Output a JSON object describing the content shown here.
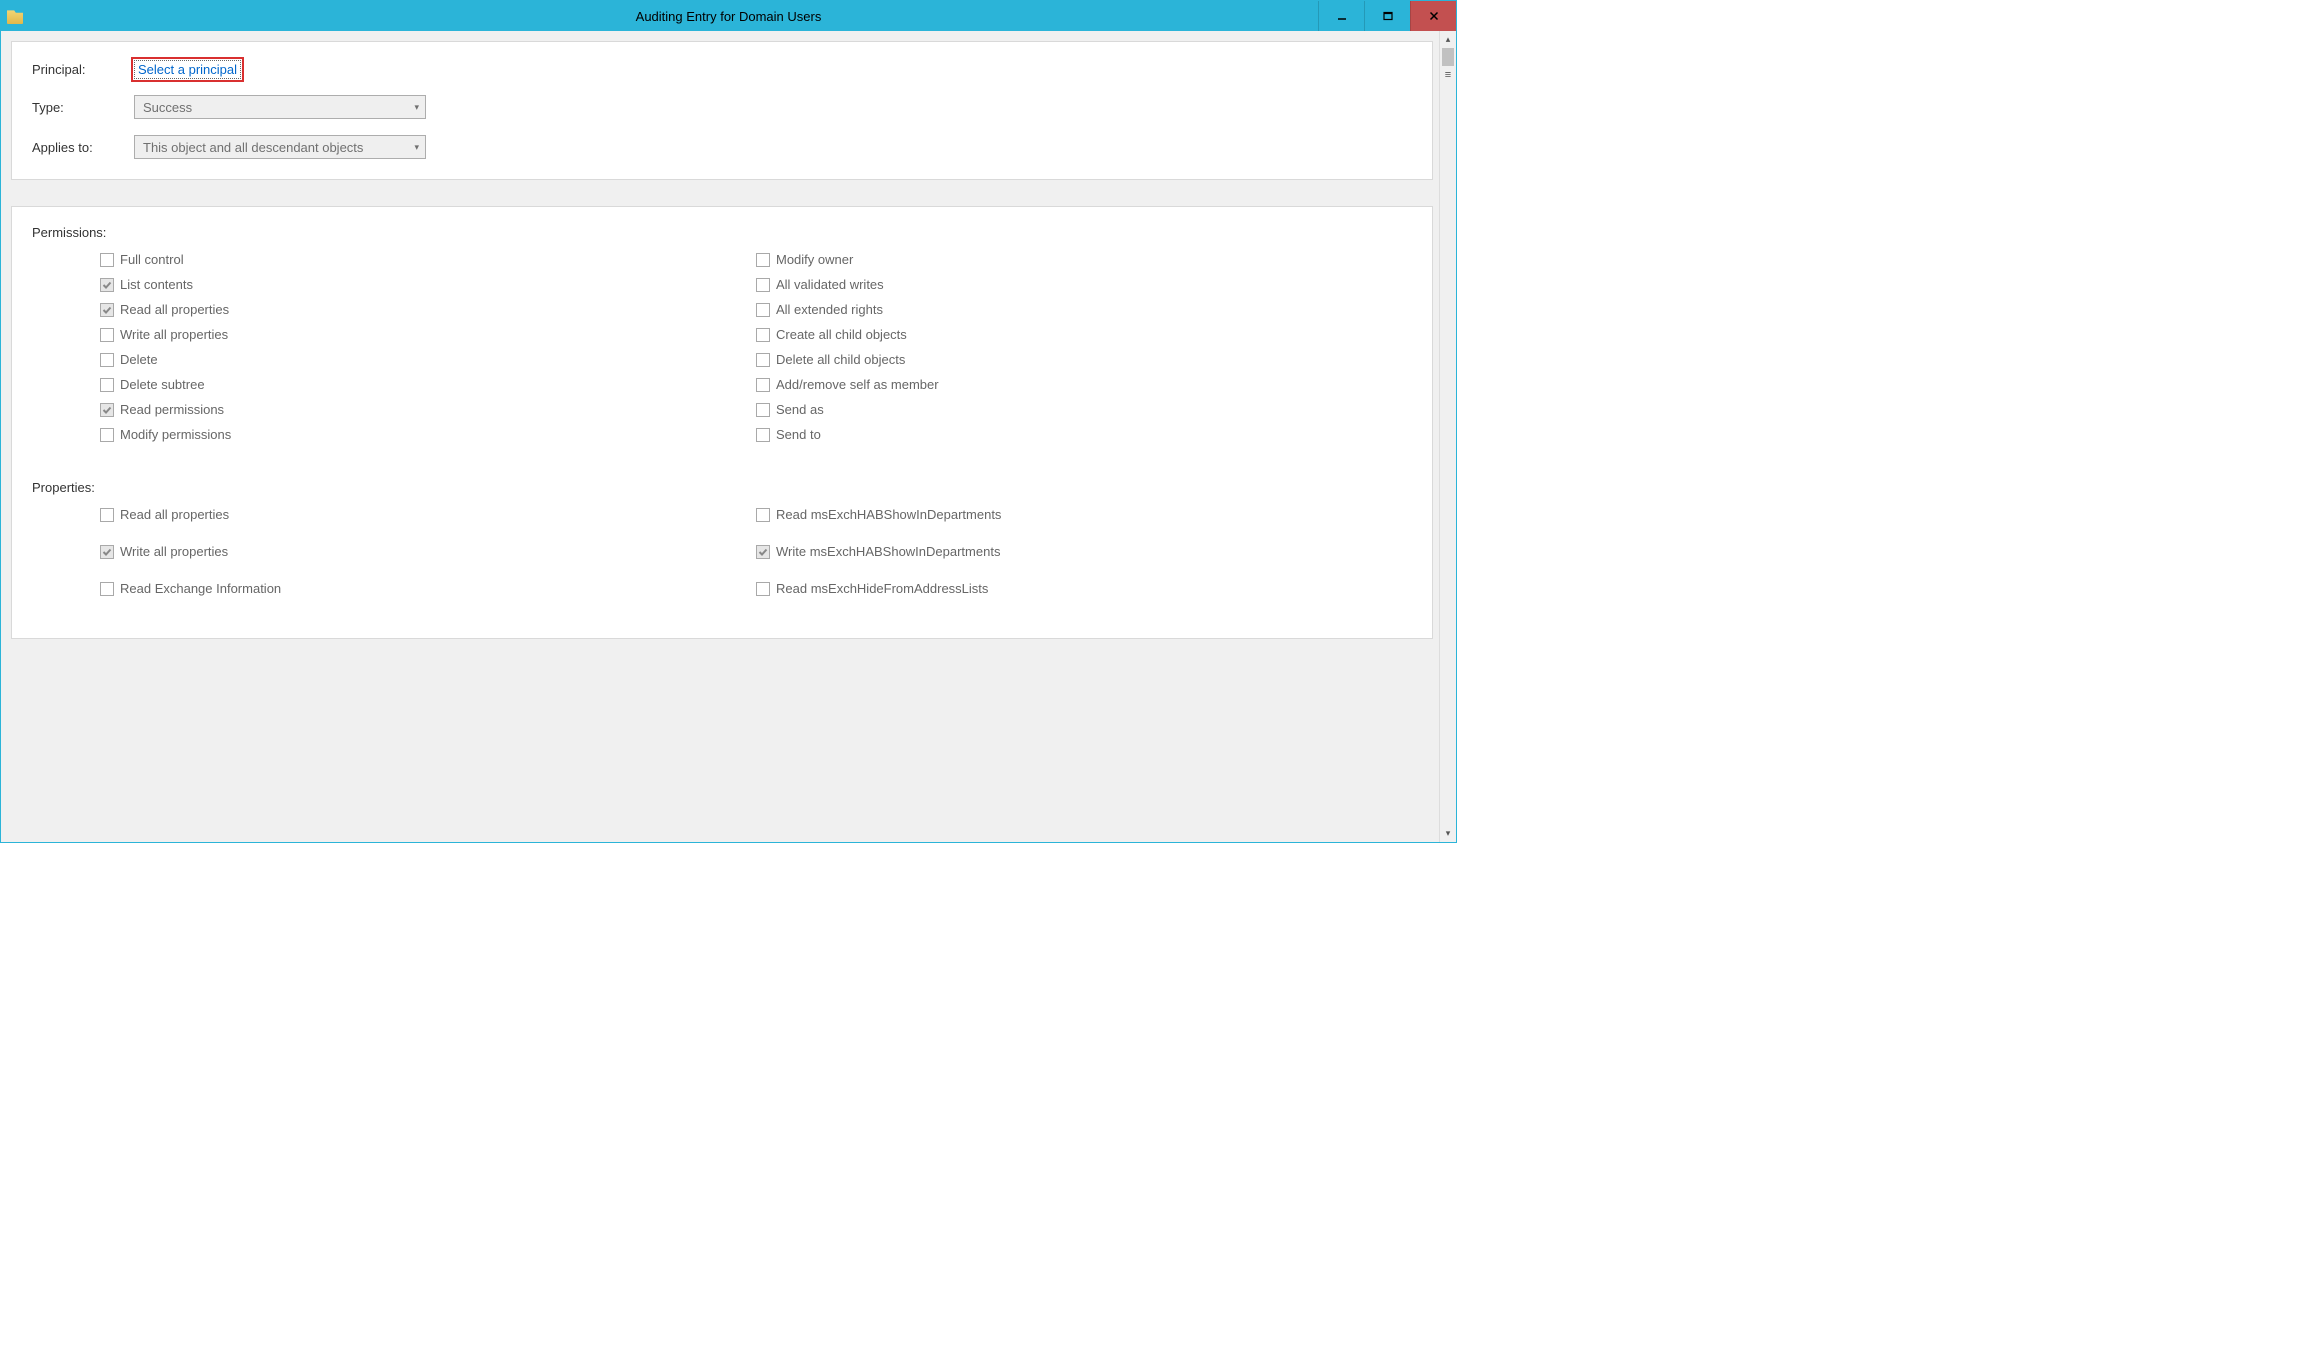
{
  "window": {
    "title": "Auditing Entry for Domain Users"
  },
  "form": {
    "principal_label": "Principal:",
    "principal_link": "Select a principal",
    "type_label": "Type:",
    "type_value": "Success",
    "appliesto_label": "Applies to:",
    "appliesto_value": "This object and all descendant objects"
  },
  "permissions": {
    "heading": "Permissions:",
    "col1": [
      {
        "label": "Full control",
        "checked": false
      },
      {
        "label": "List contents",
        "checked": true
      },
      {
        "label": "Read all properties",
        "checked": true
      },
      {
        "label": "Write all properties",
        "checked": false
      },
      {
        "label": "Delete",
        "checked": false
      },
      {
        "label": "Delete subtree",
        "checked": false
      },
      {
        "label": "Read permissions",
        "checked": true
      },
      {
        "label": "Modify permissions",
        "checked": false
      }
    ],
    "col2": [
      {
        "label": "Modify owner",
        "checked": false
      },
      {
        "label": "All validated writes",
        "checked": false
      },
      {
        "label": "All extended rights",
        "checked": false
      },
      {
        "label": "Create all child objects",
        "checked": false
      },
      {
        "label": "Delete all child objects",
        "checked": false
      },
      {
        "label": "Add/remove self as member",
        "checked": false
      },
      {
        "label": "Send as",
        "checked": false
      },
      {
        "label": "Send to",
        "checked": false
      }
    ]
  },
  "properties": {
    "heading": "Properties:",
    "col1": [
      {
        "label": "Read all properties",
        "checked": false
      },
      {
        "label": "Write all properties",
        "checked": true
      },
      {
        "label": "Read Exchange Information",
        "checked": false
      }
    ],
    "col2": [
      {
        "label": "Read msExchHABShowInDepartments",
        "checked": false
      },
      {
        "label": "Write msExchHABShowInDepartments",
        "checked": true
      },
      {
        "label": "Read msExchHideFromAddressLists",
        "checked": false
      }
    ]
  }
}
